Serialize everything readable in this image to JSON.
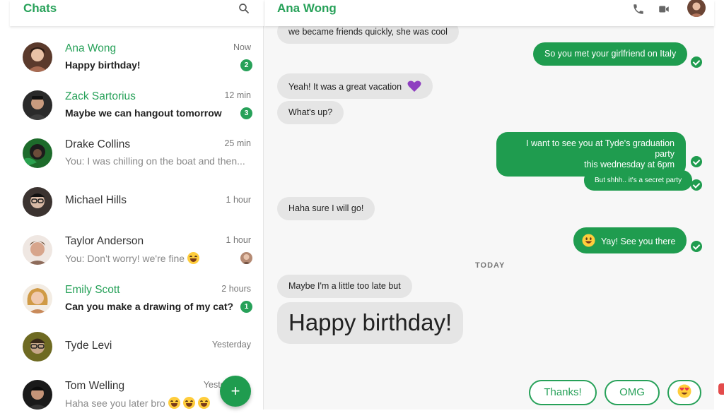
{
  "sidebar": {
    "title": "Chats",
    "search_icon": "search-icon",
    "fab_label": "+",
    "chats": [
      {
        "name": "Ana Wong",
        "message": "Happy birthday!",
        "time": "Now",
        "badge": "2",
        "unread": true,
        "avatar_color": "#8a5a44"
      },
      {
        "name": "Zack Sartorius",
        "message": "Maybe we can hangout tomorrow",
        "time": "12 min",
        "badge": "3",
        "unread": true,
        "avatar_color": "#3a3a3a"
      },
      {
        "name": "Drake Collins",
        "message": "You: I was chilling on the boat and then...",
        "time": "25 min",
        "unread": false,
        "avatar_color": "#2e7d32"
      },
      {
        "name": "Michael Hills",
        "message": "",
        "time": "1 hour",
        "unread": false,
        "avatar_color": "#4a3f3a"
      },
      {
        "name": "Taylor Anderson",
        "message": "You: Don't worry! we're fine",
        "time": "1 hour",
        "unread": false,
        "avatar_color": "#b07a63"
      },
      {
        "name": "Emily Scott",
        "message": "Can you make a drawing of my cat?",
        "time": "2 hours",
        "badge": "1",
        "unread": true,
        "avatar_color": "#d9a45a"
      },
      {
        "name": "Tyde Levi",
        "message": "",
        "time": "Yesterday",
        "unread": false,
        "avatar_color": "#7a7a2a"
      },
      {
        "name": "Tom Welling",
        "message": "Haha see you later bro",
        "time": "Yesterday",
        "unread": false,
        "avatar_color": "#222222"
      }
    ]
  },
  "conversation": {
    "title": "Ana Wong",
    "header_icons": [
      "phone-icon",
      "video-camera-icon"
    ],
    "day_separator": "TODAY",
    "messages": [
      {
        "dir": "in",
        "text": "we became friends quickly, she was cool"
      },
      {
        "dir": "out",
        "text": "So you met your girlfriend on Italy"
      },
      {
        "dir": "in",
        "text": "Yeah! It was a great vacation"
      },
      {
        "dir": "in",
        "text": "What's up?"
      },
      {
        "dir": "out",
        "text": "I want to see you at Tyde's graduation party",
        "text2": "this wednesday at 6pm"
      },
      {
        "dir": "out",
        "text": "But shhh.. it's a secret party"
      },
      {
        "dir": "in",
        "text": "Haha sure I will go!"
      },
      {
        "dir": "out",
        "text": "Yay! See you there"
      },
      {
        "dir": "in",
        "text": "Maybe I'm a little too late but"
      },
      {
        "dir": "in",
        "text": "Happy birthday!"
      }
    ],
    "quick_replies": [
      "Thanks!",
      "OMG"
    ]
  },
  "colors": {
    "accent": "#27a159",
    "bubble_out": "#1f9c4f",
    "bubble_in": "#e5e5e5"
  }
}
